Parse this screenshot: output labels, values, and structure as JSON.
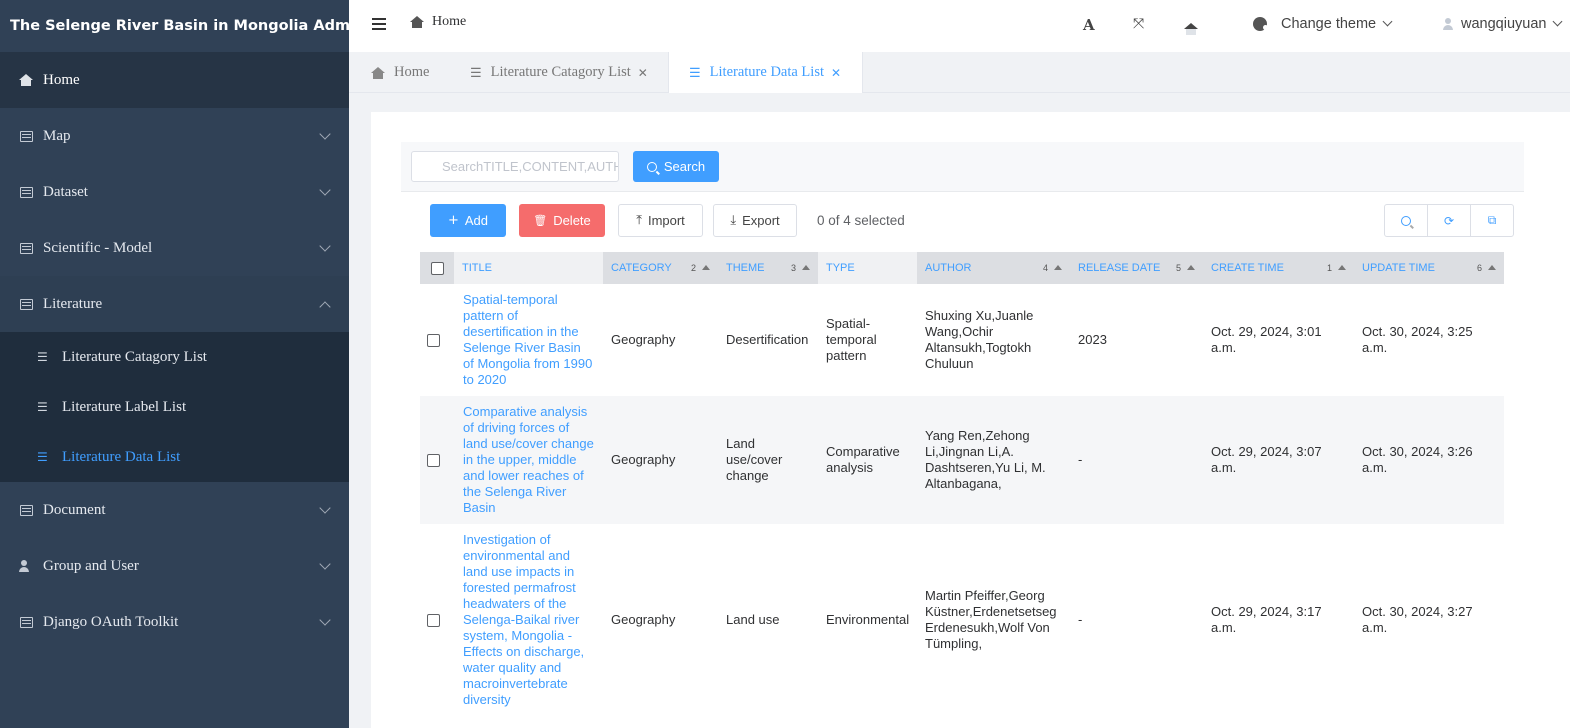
{
  "app": {
    "title": "The Selenge River Basin in Mongolia Admin"
  },
  "sidebar": {
    "items": [
      {
        "label": "Home"
      },
      {
        "label": "Map"
      },
      {
        "label": "Dataset"
      },
      {
        "label": "Scientific - Model"
      },
      {
        "label": "Literature"
      },
      {
        "label": "Document"
      },
      {
        "label": "Group and User"
      },
      {
        "label": "Django OAuth Toolkit"
      }
    ],
    "literature_sub": [
      {
        "label": "Literature Catagory List"
      },
      {
        "label": "Literature Label List"
      },
      {
        "label": "Literature Data List"
      }
    ]
  },
  "navbar": {
    "breadcrumb": "Home",
    "font_tool": "A",
    "theme_label": "Change theme",
    "user": "wangqiuyuan"
  },
  "tabs": [
    {
      "label": "Home"
    },
    {
      "label": "Literature Catagory List",
      "close": "✕"
    },
    {
      "label": "Literature Data List",
      "close": "✕"
    }
  ],
  "search": {
    "placeholder": "SearchTITLE,CONTENT,AUTHOR",
    "button": "Search"
  },
  "toolbar": {
    "add": "Add",
    "delete": "Delete",
    "import": "Import",
    "export": "Export",
    "selected": "0 of 4 selected"
  },
  "table": {
    "columns": [
      {
        "label": "TITLE",
        "sort": ""
      },
      {
        "label": "CATEGORY",
        "sort": "2"
      },
      {
        "label": "THEME",
        "sort": "3"
      },
      {
        "label": "TYPE",
        "sort": ""
      },
      {
        "label": "AUTHOR",
        "sort": "4"
      },
      {
        "label": "RELEASE DATE",
        "sort": "5"
      },
      {
        "label": "CREATE TIME",
        "sort": "1"
      },
      {
        "label": "UPDATE TIME",
        "sort": "6"
      }
    ],
    "rows": [
      {
        "title": "Spatial-temporal pattern of desertification in the Selenge River Basin of Mongolia from 1990 to 2020",
        "category": "Geography",
        "theme": "Desertification",
        "type": "Spatial-temporal pattern",
        "author": "Shuxing Xu,Juanle Wang,Ochir Altansukh,Togtokh Chuluun",
        "release": "2023",
        "created": "Oct. 29, 2024, 3:01 a.m.",
        "updated": "Oct. 30, 2024, 3:25 a.m."
      },
      {
        "title": "Comparative analysis of driving forces of land use/cover change in the upper, middle and lower reaches of the Selenga River Basin",
        "category": "Geography",
        "theme": "Land use/cover change",
        "type": "Comparative analysis",
        "author": "Yang Ren,Zehong Li,Jingnan Li,A. Dashtseren,Yu Li, M. Altanbagana,",
        "release": "-",
        "created": "Oct. 29, 2024, 3:07 a.m.",
        "updated": "Oct. 30, 2024, 3:26 a.m."
      },
      {
        "title": "Investigation of environmental and land use impacts in forested permafrost headwaters of the Selenga-Baikal river system, Mongolia - Effects on discharge, water quality and macroinvertebrate diversity",
        "category": "Geography",
        "theme": "Land use",
        "type": "Environmental",
        "author": "Martin Pfeiffer,Georg Küstner,Erdenetsetseg Erdenesukh,Wolf Von Tümpling,",
        "release": "-",
        "created": "Oct. 29, 2024, 3:17 a.m.",
        "updated": "Oct. 30, 2024, 3:27 a.m."
      }
    ]
  }
}
